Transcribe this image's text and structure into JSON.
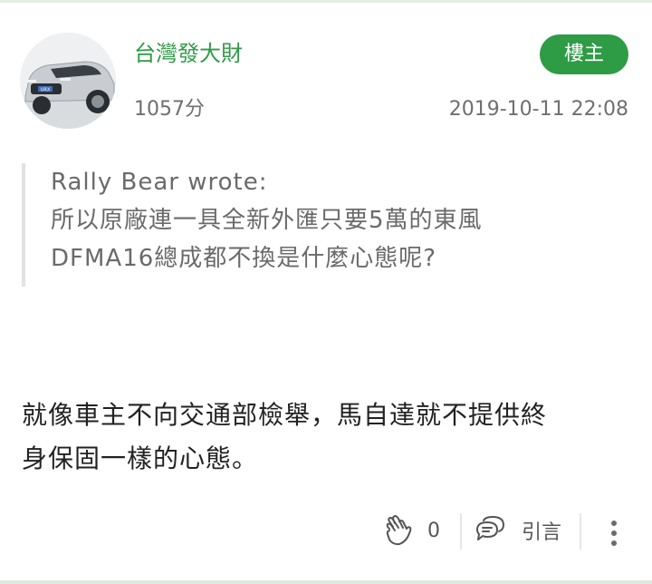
{
  "post": {
    "author": "台灣發大財",
    "badge": "樓主",
    "score": "1057分",
    "timestamp": "2019-10-11 22:08",
    "quote": {
      "author_line": "Rally Bear wrote:",
      "lines": [
        "所以原廠連一具全新外匯只要5萬的東風",
        "DFMA16總成都不換是什麼心態呢?"
      ]
    },
    "body_lines": [
      "就像車主不向交通部檢舉，馬自達就不提供終",
      "身保固一樣的心態。"
    ],
    "actions": {
      "like_icon": "clap-icon",
      "like_count": "0",
      "quote_icon": "quote-bubble-icon",
      "quote_label": "引言",
      "more_icon": "more-vertical-icon"
    }
  },
  "colors": {
    "accent": "#2e9b45",
    "meta_text": "#6f6f6f",
    "quote_text": "#6a6a6a"
  }
}
